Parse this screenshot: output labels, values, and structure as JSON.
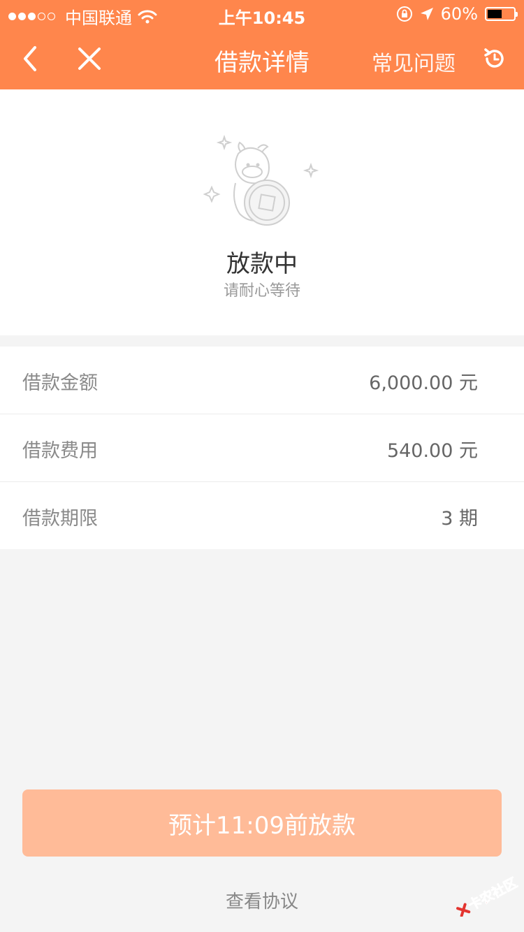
{
  "status_bar": {
    "carrier": "中国联通",
    "time": "上午10:45",
    "battery_percent": "60%",
    "signal_full": 3,
    "signal_total": 5,
    "battery_level": 0.6
  },
  "nav": {
    "back_icon": "chevron-left-icon",
    "close_icon": "close-icon",
    "title": "借款详情",
    "faq_label": "常见问题",
    "refresh_icon": "refresh-icon"
  },
  "loan_status": {
    "title": "放款中",
    "subtitle": "请耐心等待"
  },
  "details": [
    {
      "label": "借款金额",
      "value": "6,000.00 元"
    },
    {
      "label": "借款费用",
      "value": "540.00 元"
    },
    {
      "label": "借款期限",
      "value": "3 期"
    }
  ],
  "actions": {
    "main_button_label": "预计11:09前放款",
    "agreement_link": "查看协议"
  },
  "watermark": {
    "text": "卡农社区"
  },
  "colors": {
    "accent": "#ff864c",
    "button_disabled": "#ffbb98"
  }
}
